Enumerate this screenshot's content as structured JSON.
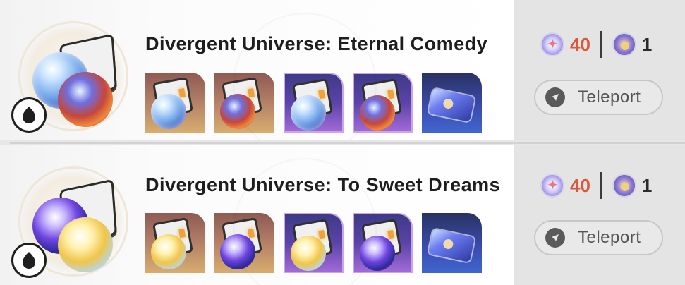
{
  "rows": [
    {
      "title": "Divergent Universe: Eternal Comedy",
      "path_icon": "abundance-path-icon",
      "emblem_orbs": [
        "blue",
        "red"
      ],
      "items": [
        {
          "rarity": "r3",
          "kind": "cube-orb",
          "orb": "blue",
          "icon": "planar-ornament-sphere-icon"
        },
        {
          "rarity": "r3",
          "kind": "cube-orb",
          "orb": "red",
          "icon": "planar-ornament-rope-icon"
        },
        {
          "rarity": "r4",
          "kind": "cube-orb",
          "orb": "blue",
          "icon": "planar-ornament-sphere-icon"
        },
        {
          "rarity": "r4",
          "kind": "cube-orb",
          "orb": "red",
          "icon": "planar-ornament-rope-icon"
        },
        {
          "rarity": "r5",
          "kind": "pass",
          "icon": "credit-pass-icon"
        }
      ],
      "cost": {
        "power_value": "40",
        "immersion_value": "1"
      },
      "teleport_label": "Teleport"
    },
    {
      "title": "Divergent Universe: To Sweet Dreams",
      "path_icon": "abundance-path-icon",
      "emblem_orbs": [
        "purple",
        "gold"
      ],
      "items": [
        {
          "rarity": "r3",
          "kind": "cube-orb",
          "orb": "gold",
          "icon": "planar-ornament-sphere-icon"
        },
        {
          "rarity": "r3",
          "kind": "cube-orb",
          "orb": "purple",
          "icon": "planar-ornament-rope-icon"
        },
        {
          "rarity": "r4",
          "kind": "cube-orb",
          "orb": "gold",
          "icon": "planar-ornament-sphere-icon"
        },
        {
          "rarity": "r4",
          "kind": "cube-orb",
          "orb": "purple",
          "icon": "planar-ornament-rope-icon"
        },
        {
          "rarity": "r5",
          "kind": "pass",
          "icon": "credit-pass-icon"
        }
      ],
      "cost": {
        "power_value": "40",
        "immersion_value": "1"
      },
      "teleport_label": "Teleport"
    }
  ],
  "colors": {
    "cost_red": "#d9583b",
    "rarity_3": "#c5955f",
    "rarity_4": "#7a55c6",
    "rarity_5": "#3f55b8"
  }
}
